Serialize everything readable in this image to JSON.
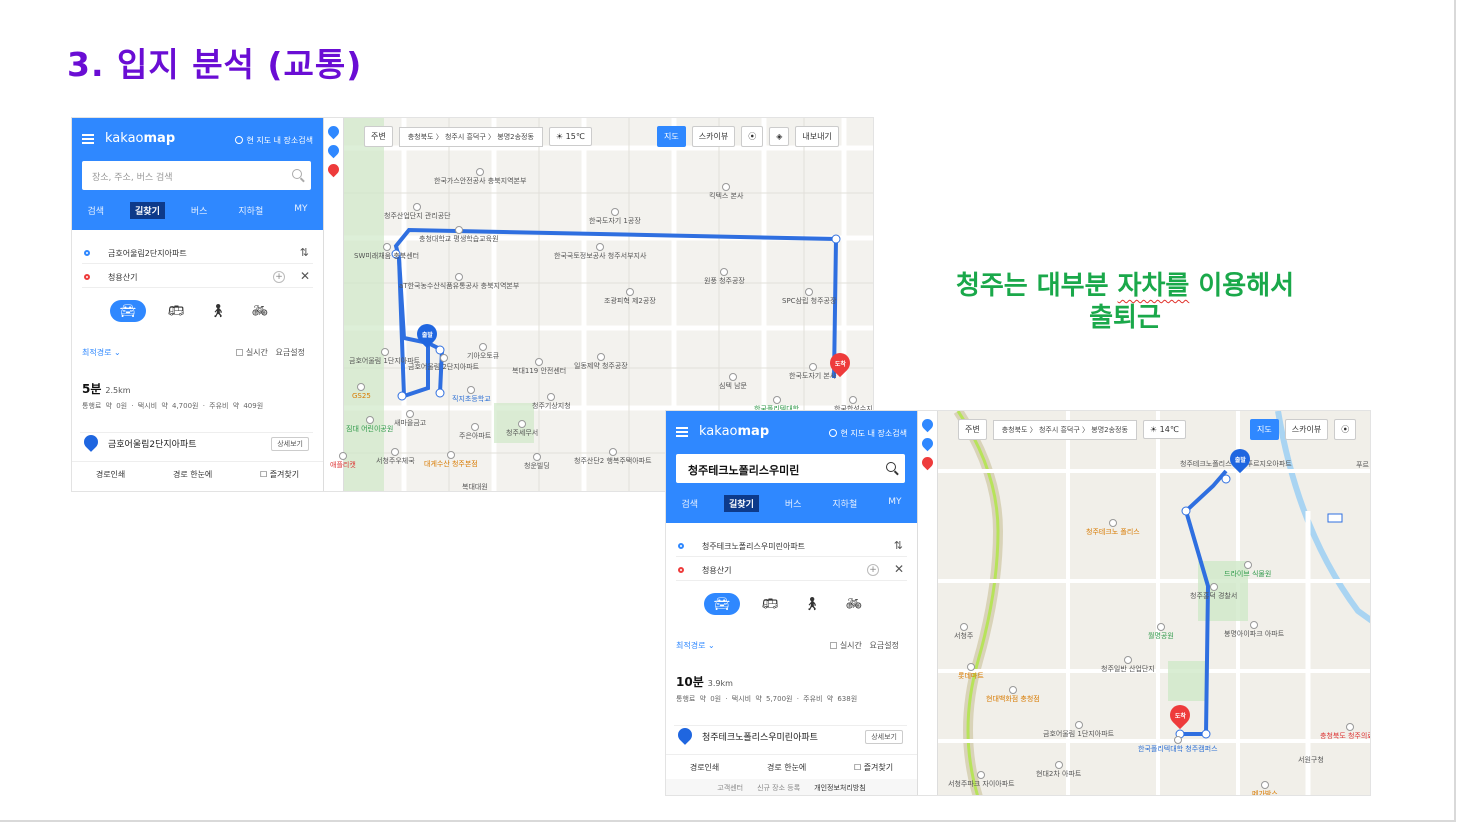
{
  "slide": {
    "title": "3. 입지 분석 (교통)",
    "caption_line1_a": "청주는 대부분 ",
    "caption_line1_b": "자차를",
    "caption_line1_c": " 이용해서",
    "caption_line2": "출퇴근"
  },
  "colors": {
    "title": "#6a0dd4",
    "caption": "#1aa84a",
    "kakao_blue": "#2f88ff",
    "route": "#2f6fe0"
  },
  "map1": {
    "logo_a": "kakao",
    "logo_b": "map",
    "nearby": "현 지도 내 장소검색",
    "search_placeholder": "장소, 주소, 버스 검색",
    "tabs": [
      "검색",
      "길찾기",
      "버스",
      "지하철",
      "MY"
    ],
    "origin": "금호어울림2단지아파트",
    "destination": "청용산기",
    "modes": [
      "car-icon",
      "bus-icon",
      "walk-icon",
      "bike-icon"
    ],
    "best_route": "최적경로 ⌄",
    "realtime": "실시간",
    "fare_setting": "요금설정",
    "time": "5분",
    "distance": "2.5km",
    "fare": "통행료 약 0원 · 택시비 약 4,700원 · 주유비 약 409원",
    "dest_item": "금호어울림2단지아파트",
    "detail": "상세보기",
    "actions": [
      "경로인쇄",
      "경로 한눈에",
      "즐겨찾기"
    ],
    "toolbar": {
      "nearby": "주변",
      "breadcrumb": "충청북도 〉 청주시 흥덕구 〉 봉명2송정동",
      "weather": "15℃",
      "map": "지도",
      "skyview": "스카이뷰",
      "share": "내보내기"
    },
    "pois": [
      "한국가스안전공사 충북지역본부",
      "킥텍스 본사",
      "한국도자기 1공장",
      "청주산업단지 관리공단",
      "충청대학교 평생학습교육원",
      "SW미래채움 충북센터",
      "한국국토정보공사 청주서부지사",
      "aT한국농수산식품유통공사 충북지역본부",
      "원풍 청주공장",
      "SPC삼립 청주공장",
      "조광피혁 제2공장",
      "금호어울림 1단지아파트",
      "금호어울림 2단지아파트",
      "기아오토큐",
      "복대119 안전센터",
      "일동제약 청주공장",
      "한국도자기 본사",
      "직지초등학교",
      "청주기상지청",
      "심텍 남문",
      "새마을금고",
      "주은아파트",
      "청주세무서",
      "청주산단2 행복주택아파트",
      "대게수산 청주본점",
      "서청주우체국",
      "청운빌딩",
      "복대대원",
      "한국폴리텍대학",
      "한국합성수지",
      "GS25",
      "짐대 어린이공원",
      "애플리캣"
    ],
    "start_label": "출발",
    "end_label": "도착"
  },
  "map2": {
    "logo_a": "kakao",
    "logo_b": "map",
    "nearby": "현 지도 내 장소검색",
    "search_value": "청주테크노폴리스우미린",
    "tabs": [
      "검색",
      "길찾기",
      "버스",
      "지하철",
      "MY"
    ],
    "origin": "청주테크노폴리스우미린아파트",
    "destination": "청용산기",
    "best_route": "최적경로 ⌄",
    "realtime": "실시간",
    "fare_setting": "요금설정",
    "time": "10분",
    "distance": "3.9km",
    "fare": "통행료 약 0원 · 택시비 약 5,700원 · 주유비 약 638원",
    "dest_item": "청주테크노폴리스우미린아파트",
    "detail": "상세보기",
    "actions": [
      "경로인쇄",
      "경로 한눈에",
      "즐겨찾기"
    ],
    "footer": [
      "고객센터",
      "신규 장소 등록",
      "개인정보처리방침"
    ],
    "toolbar": {
      "nearby": "주변",
      "breadcrumb": "충청북도 〉 청주시 흥덕구 〉 봉명2송정동",
      "weather": "14℃",
      "map": "지도",
      "skyview": "스카이뷰"
    },
    "pois": [
      "청주테크노폴리스 지웰푸르지오아파트",
      "청주테크노 폴리스",
      "드라이브 식물원",
      "청주흥덕 경찰서",
      "월명공원",
      "봉명아이파크 아파트",
      "청주일반 산업단지",
      "롯데마트",
      "현대백화점 충청점",
      "금호어울림 1단지아파트",
      "현대2차 아파트",
      "한국폴리텍대학 청주캠퍼스",
      "서청주파크 자이아파트",
      "충청북도 청주의료원",
      "서원구청",
      "서청주",
      "메가박스",
      "푸르"
    ],
    "start_label": "출발",
    "end_label": "도착"
  }
}
